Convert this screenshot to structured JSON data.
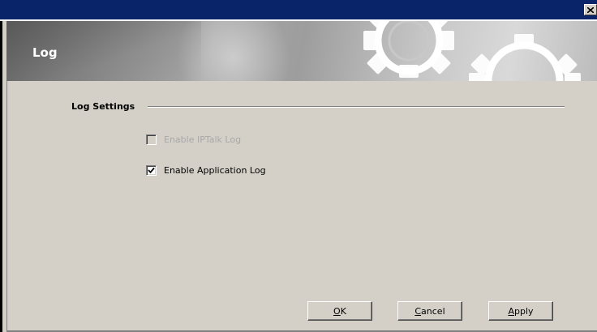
{
  "window": {
    "close_icon": "close-icon"
  },
  "banner": {
    "title": "Log",
    "decoration_icon": "gears-icon"
  },
  "section": {
    "title": "Log Settings"
  },
  "options": [
    {
      "label": "Enable IPTalk Log",
      "checked": false,
      "enabled": false
    },
    {
      "label": "Enable Application Log",
      "checked": true,
      "enabled": true
    }
  ],
  "buttons": {
    "ok": {
      "accel": "O",
      "rest": "K"
    },
    "cancel": {
      "accel": "C",
      "rest": "ancel"
    },
    "apply": {
      "accel": "A",
      "rest": "pply"
    }
  },
  "colors": {
    "titlebar": "#0a246a",
    "dialog_bg": "#d4d0c8",
    "disabled_text": "#a8a8a8"
  }
}
